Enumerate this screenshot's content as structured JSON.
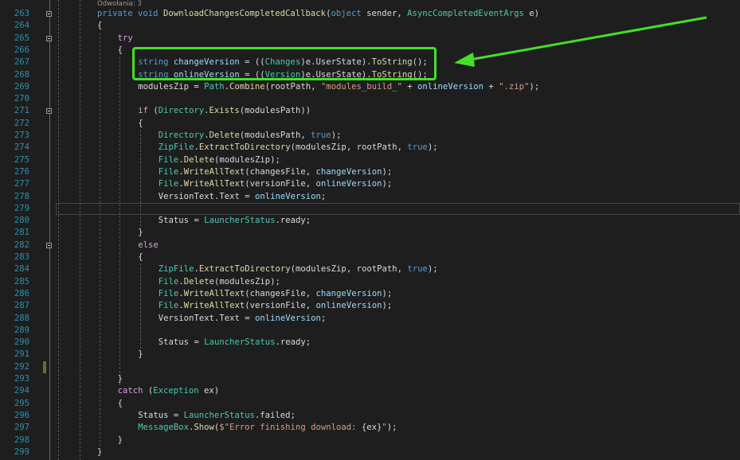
{
  "code_lens": "Odwołania: 3",
  "colors": {
    "keyword": "#569cd6",
    "control": "#d8a0df",
    "type": "#4ec9b0",
    "method": "#dcdcaa",
    "variable": "#9cdcfe",
    "string": "#d69d85",
    "line_number": "#2b91af",
    "annotation": "#44e025"
  },
  "current_line": 279,
  "changed_line": 292,
  "folded_lines": [
    263,
    265,
    271,
    282
  ],
  "lines": [
    {
      "n": 263,
      "i": 0,
      "t": [
        [
          "k",
          "private"
        ],
        [
          "p",
          " "
        ],
        [
          "k",
          "void"
        ],
        [
          "p",
          " "
        ],
        [
          "m",
          "DownloadChangesCompletedCallback"
        ],
        [
          "p",
          "("
        ],
        [
          "k",
          "object"
        ],
        [
          "p",
          " sender, "
        ],
        [
          "t",
          "AsyncCompletedEventArgs"
        ],
        [
          "p",
          " e)"
        ]
      ]
    },
    {
      "n": 264,
      "i": 0,
      "t": [
        [
          "p",
          "{"
        ]
      ]
    },
    {
      "n": 265,
      "i": 1,
      "t": [
        [
          "c",
          "try"
        ]
      ]
    },
    {
      "n": 266,
      "i": 1,
      "t": [
        [
          "p",
          "{"
        ]
      ]
    },
    {
      "n": 267,
      "i": 2,
      "t": [
        [
          "k",
          "string"
        ],
        [
          "p",
          " "
        ],
        [
          "v",
          "changeVersion"
        ],
        [
          "p",
          " = (("
        ],
        [
          "t",
          "Changes"
        ],
        [
          "p",
          ")e.UserState)."
        ],
        [
          "m",
          "ToString"
        ],
        [
          "p",
          "();"
        ]
      ]
    },
    {
      "n": 268,
      "i": 2,
      "t": [
        [
          "k",
          "string"
        ],
        [
          "p",
          " "
        ],
        [
          "v",
          "onlineVersion"
        ],
        [
          "p",
          " = (("
        ],
        [
          "t",
          "Version"
        ],
        [
          "p",
          ")e.UserState)."
        ],
        [
          "m",
          "ToString"
        ],
        [
          "p",
          "();"
        ]
      ]
    },
    {
      "n": 269,
      "i": 2,
      "t": [
        [
          "p",
          "modulesZip = "
        ],
        [
          "t",
          "Path"
        ],
        [
          "p",
          "."
        ],
        [
          "m",
          "Combine"
        ],
        [
          "p",
          "(rootPath, "
        ],
        [
          "s",
          "\"modules_build_\""
        ],
        [
          "p",
          " + "
        ],
        [
          "v",
          "onlineVersion"
        ],
        [
          "p",
          " + "
        ],
        [
          "s",
          "\".zip\""
        ],
        [
          "p",
          ");"
        ]
      ]
    },
    {
      "n": 270,
      "i": 0,
      "t": []
    },
    {
      "n": 271,
      "i": 2,
      "t": [
        [
          "c",
          "if"
        ],
        [
          "p",
          " ("
        ],
        [
          "t",
          "Directory"
        ],
        [
          "p",
          "."
        ],
        [
          "m",
          "Exists"
        ],
        [
          "p",
          "(modulesPath))"
        ]
      ]
    },
    {
      "n": 272,
      "i": 2,
      "t": [
        [
          "p",
          "{"
        ]
      ]
    },
    {
      "n": 273,
      "i": 3,
      "t": [
        [
          "t",
          "Directory"
        ],
        [
          "p",
          "."
        ],
        [
          "m",
          "Delete"
        ],
        [
          "p",
          "(modulesPath, "
        ],
        [
          "k",
          "true"
        ],
        [
          "p",
          ");"
        ]
      ]
    },
    {
      "n": 274,
      "i": 3,
      "t": [
        [
          "t",
          "ZipFile"
        ],
        [
          "p",
          "."
        ],
        [
          "m",
          "ExtractToDirectory"
        ],
        [
          "p",
          "(modulesZip, rootPath, "
        ],
        [
          "k",
          "true"
        ],
        [
          "p",
          ");"
        ]
      ]
    },
    {
      "n": 275,
      "i": 3,
      "t": [
        [
          "t",
          "File"
        ],
        [
          "p",
          "."
        ],
        [
          "m",
          "Delete"
        ],
        [
          "p",
          "(modulesZip);"
        ]
      ]
    },
    {
      "n": 276,
      "i": 3,
      "t": [
        [
          "t",
          "File"
        ],
        [
          "p",
          "."
        ],
        [
          "m",
          "WriteAllText"
        ],
        [
          "p",
          "(changesFile, "
        ],
        [
          "v",
          "changeVersion"
        ],
        [
          "p",
          ");"
        ]
      ]
    },
    {
      "n": 277,
      "i": 3,
      "t": [
        [
          "t",
          "File"
        ],
        [
          "p",
          "."
        ],
        [
          "m",
          "WriteAllText"
        ],
        [
          "p",
          "(versionFile, "
        ],
        [
          "v",
          "onlineVersion"
        ],
        [
          "p",
          ");"
        ]
      ]
    },
    {
      "n": 278,
      "i": 3,
      "t": [
        [
          "p",
          "VersionText.Text = "
        ],
        [
          "v",
          "onlineVersion"
        ],
        [
          "p",
          ";"
        ]
      ]
    },
    {
      "n": 279,
      "i": 0,
      "t": []
    },
    {
      "n": 280,
      "i": 3,
      "t": [
        [
          "p",
          "Status = "
        ],
        [
          "t",
          "LauncherStatus"
        ],
        [
          "p",
          ".ready;"
        ]
      ]
    },
    {
      "n": 281,
      "i": 2,
      "t": [
        [
          "p",
          "}"
        ]
      ]
    },
    {
      "n": 282,
      "i": 2,
      "t": [
        [
          "c",
          "else"
        ]
      ]
    },
    {
      "n": 283,
      "i": 2,
      "t": [
        [
          "p",
          "{"
        ]
      ]
    },
    {
      "n": 284,
      "i": 3,
      "t": [
        [
          "t",
          "ZipFile"
        ],
        [
          "p",
          "."
        ],
        [
          "m",
          "ExtractToDirectory"
        ],
        [
          "p",
          "(modulesZip, rootPath, "
        ],
        [
          "k",
          "true"
        ],
        [
          "p",
          ");"
        ]
      ]
    },
    {
      "n": 285,
      "i": 3,
      "t": [
        [
          "t",
          "File"
        ],
        [
          "p",
          "."
        ],
        [
          "m",
          "Delete"
        ],
        [
          "p",
          "(modulesZip);"
        ]
      ]
    },
    {
      "n": 286,
      "i": 3,
      "t": [
        [
          "t",
          "File"
        ],
        [
          "p",
          "."
        ],
        [
          "m",
          "WriteAllText"
        ],
        [
          "p",
          "(changesFile, "
        ],
        [
          "v",
          "changeVersion"
        ],
        [
          "p",
          ");"
        ]
      ]
    },
    {
      "n": 287,
      "i": 3,
      "t": [
        [
          "t",
          "File"
        ],
        [
          "p",
          "."
        ],
        [
          "m",
          "WriteAllText"
        ],
        [
          "p",
          "(versionFile, "
        ],
        [
          "v",
          "onlineVersion"
        ],
        [
          "p",
          ");"
        ]
      ]
    },
    {
      "n": 288,
      "i": 3,
      "t": [
        [
          "p",
          "VersionText.Text = "
        ],
        [
          "v",
          "onlineVersion"
        ],
        [
          "p",
          ";"
        ]
      ]
    },
    {
      "n": 289,
      "i": 0,
      "t": []
    },
    {
      "n": 290,
      "i": 3,
      "t": [
        [
          "p",
          "Status = "
        ],
        [
          "t",
          "LauncherStatus"
        ],
        [
          "p",
          ".ready;"
        ]
      ]
    },
    {
      "n": 291,
      "i": 2,
      "t": [
        [
          "p",
          "}"
        ]
      ]
    },
    {
      "n": 292,
      "i": 0,
      "t": []
    },
    {
      "n": 293,
      "i": 1,
      "t": [
        [
          "p",
          "}"
        ]
      ]
    },
    {
      "n": 294,
      "i": 1,
      "t": [
        [
          "c",
          "catch"
        ],
        [
          "p",
          " ("
        ],
        [
          "t",
          "Exception"
        ],
        [
          "p",
          " ex)"
        ]
      ]
    },
    {
      "n": 295,
      "i": 1,
      "t": [
        [
          "p",
          "{"
        ]
      ]
    },
    {
      "n": 296,
      "i": 2,
      "t": [
        [
          "p",
          "Status = "
        ],
        [
          "t",
          "LauncherStatus"
        ],
        [
          "p",
          ".failed;"
        ]
      ]
    },
    {
      "n": 297,
      "i": 2,
      "t": [
        [
          "t",
          "MessageBox"
        ],
        [
          "p",
          "."
        ],
        [
          "m",
          "Show"
        ],
        [
          "p",
          "("
        ],
        [
          "s",
          "$\"Error finishing download: "
        ],
        [
          "p",
          "{ex}"
        ],
        [
          "s",
          "\""
        ],
        [
          "p",
          ");"
        ]
      ]
    },
    {
      "n": 298,
      "i": 1,
      "t": [
        [
          "p",
          "}"
        ]
      ]
    },
    {
      "n": 299,
      "i": 0,
      "t": [
        [
          "p",
          "}"
        ]
      ]
    }
  ]
}
